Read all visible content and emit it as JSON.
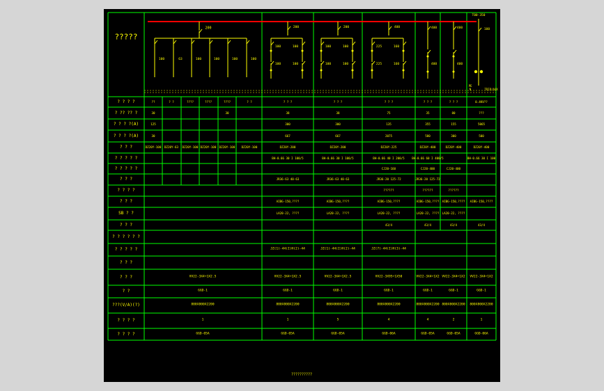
{
  "drawing": {
    "title_cell": "?????",
    "footer_caption": "??????????",
    "colors": {
      "background": "#000000",
      "grid": "#00ff00",
      "text": "#ffff00",
      "busbar": "#ff0000",
      "page": "#d6d6d6"
    },
    "diagram": {
      "main_breakers": [
        "200",
        "200",
        "200",
        "400",
        "400",
        "400",
        "100"
      ],
      "branch_breakers": [
        "100",
        "63",
        "100",
        "100",
        "100",
        "100"
      ],
      "col1_breakers": [
        "100",
        "100",
        "100",
        "100"
      ],
      "col2_breakers": [
        "100",
        "100",
        "100",
        "100"
      ],
      "col3_breakers": [
        "225",
        "225",
        "160",
        "160"
      ],
      "col4_breakers": [
        "400",
        "400"
      ],
      "col5_breakers": [
        "400",
        "400"
      ],
      "col6_top_label": "T00-350",
      "col6_breaker": "100",
      "col6_bottom_labels": [
        "PE",
        "N",
        "TRIP/AUX"
      ]
    },
    "row_labels": [
      "? ? ? ?",
      "? ?? ?? ?",
      "? ? ? ?(A)",
      "? ? ? ?(A)",
      "? ? ?",
      "? ? ? ? ?",
      "? ? ? ? ?",
      "? ? ?",
      "? ? ? ?",
      "? ? ?",
      "SB ? ?",
      "? ? ?",
      "? ? ? ? ? ?",
      "? ? ? ? ?",
      "? ? ?",
      "? ? ?",
      "? ?",
      "???(V/A)(?)",
      "? ? ? ?",
      "? ? ? ?"
    ],
    "rows": [
      [
        "??",
        "? ?",
        "????",
        "????",
        "????",
        "? ?",
        "? ? ?",
        "? ? ?",
        "? ? ?",
        "? ? ?",
        "? ? ?",
        "0.4KV??"
      ],
      [
        "30",
        "",
        "",
        "",
        "30",
        "",
        "38",
        "38",
        "75",
        "35",
        "80",
        "???"
      ],
      [
        "125",
        "",
        "",
        "",
        "",
        "",
        "300",
        "300",
        "135",
        "355",
        "155",
        "5065"
      ],
      [
        "30",
        "",
        "",
        "",
        "",
        "",
        "667",
        "667",
        "2075",
        "580",
        "300",
        "500"
      ],
      [
        "DZ20Y-100",
        "DZ20Y-63",
        "DZ20Y-100",
        "DZ20Y-100",
        "DZ20Y-100",
        "DZ20Y-100",
        "DZ20Y-200",
        "DZ20Y-200",
        "DZ20Y-225",
        "DZ20Y-400",
        "DZ20Y-400",
        "DZ20Y-400"
      ],
      [
        "",
        "",
        "",
        "",
        "",
        "",
        "BH-0.66 30 I 100/5",
        "BH-0.66 30 I 100/5",
        "BH-0.66 40 I 200/5",
        "BH-0.66 60 I 400/5",
        "",
        "BH-0.66 30 I 100"
      ],
      [
        "",
        "",
        "",
        "",
        "",
        "",
        "",
        "",
        "CJ20-160",
        "CJ20-400",
        "CJ20-400",
        ""
      ],
      [
        "",
        "",
        "",
        "",
        "",
        "",
        "JR36-63 40-63",
        "JR36-63 40-63",
        "JR36-20 125-72",
        "JR36-20 125-72",
        "",
        ""
      ],
      [
        "",
        "",
        "",
        "",
        "",
        "",
        "",
        "",
        "??????",
        "??????",
        "??????",
        ""
      ],
      [
        "",
        "",
        "",
        "",
        "",
        "",
        "AIBG-150,????",
        "AIBG-150,????",
        "AIBG-150,????",
        "AIBG-150,????",
        "AIBG-150,????",
        "AIBG-150,????"
      ],
      [
        "",
        "",
        "",
        "",
        "",
        "",
        "LA20-22, ????",
        "LA20-22, ????",
        "LA20-22, ????",
        "LA20-22, ????",
        "LA20-22, ????",
        ""
      ],
      [
        "",
        "",
        "",
        "",
        "",
        "",
        "",
        "",
        "43/4",
        "43/4",
        "43/4",
        "43/4"
      ],
      [
        "",
        "",
        "",
        "",
        "",
        "",
        "",
        "",
        "",
        "",
        "",
        ""
      ],
      [
        "",
        "",
        "",
        "",
        "",
        "",
        "JZ(1)-44(I)H(2)-44",
        "JZ(1)-44(I)H(2)-44",
        "JZ(7)-44(I)H(3)-44",
        "",
        "",
        ""
      ],
      [
        "",
        "",
        "",
        "",
        "",
        "",
        "",
        "",
        "",
        "",
        "",
        ""
      ],
      [
        "VV22-3X4+1X2.5",
        "",
        "",
        "",
        "",
        "",
        "VV22-3X4+1X2.5",
        "VV22-3X4+1X2.5",
        "VV22-3X95+1X50",
        "VV22-3X4+1X2",
        "VV22-3X4+1X2",
        "VV22-3X4+1X2"
      ],
      [
        "GGD-1",
        "",
        "",
        "",
        "",
        "",
        "GGD-1",
        "GGD-1",
        "GGD-1",
        "GGD-1",
        "GGD-1",
        "GGD-1"
      ],
      [
        "800X800X2200",
        "",
        "",
        "",
        "",
        "",
        "800X800X2200",
        "800X800X2200",
        "800X800X2200",
        "800X800X2200",
        "800X800X2200",
        "800X800X2200"
      ],
      [
        "1",
        "",
        "",
        "",
        "",
        "",
        "1",
        "5",
        "4",
        "4",
        "2",
        "1"
      ],
      [
        "GGD-05A",
        "",
        "",
        "",
        "",
        "",
        "GGD-05A",
        "GGD-05A",
        "GGD-06A",
        "GGD-05A",
        "GGD-05A",
        "GGD-06A"
      ]
    ]
  }
}
